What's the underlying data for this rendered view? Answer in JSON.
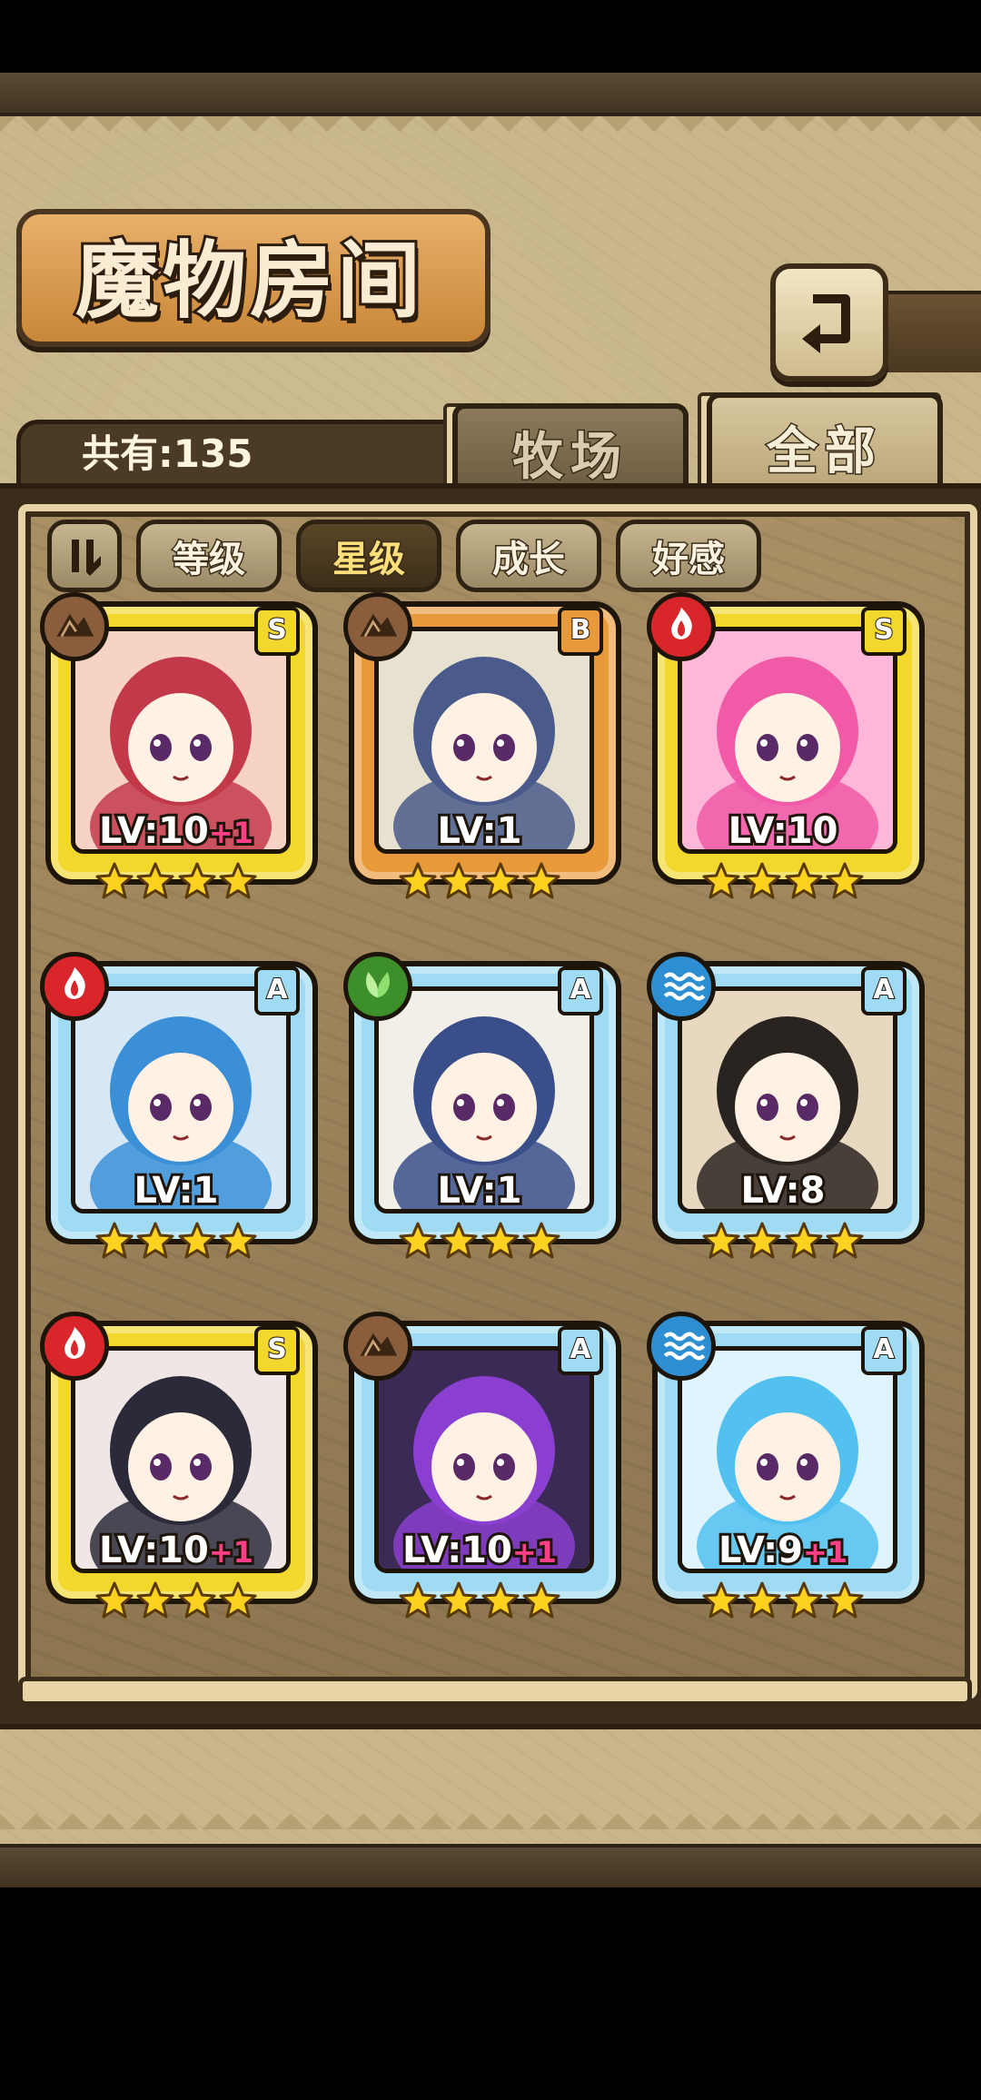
{
  "screen": {
    "title": "魔物房间",
    "back_icon": "back-arrow-icon",
    "total_count": "共有:135"
  },
  "tabs": [
    {
      "label": "牧场",
      "active": false
    },
    {
      "label": "全部",
      "active": true
    }
  ],
  "sort": {
    "toggle_icon": "sort-toggle-icon",
    "buttons": [
      {
        "label": "等级",
        "active": false
      },
      {
        "label": "星级",
        "active": true
      },
      {
        "label": "成长",
        "active": false
      },
      {
        "label": "好感",
        "active": false
      }
    ]
  },
  "colors": {
    "gold_frame": "#f2d72c",
    "bronze_frame": "#e89a3a",
    "blue_frame": "#9fdcf3",
    "earth": "#8a5e3c",
    "fire": "#d9262b",
    "nature": "#3d8f2c",
    "water": "#2d8fd1",
    "level_plus": "#ff3f86"
  },
  "monsters": [
    {
      "rank": "S",
      "element": "earth",
      "level": "LV:10",
      "plus": "+1",
      "stars": 4,
      "frame": "gold"
    },
    {
      "rank": "B",
      "element": "earth",
      "level": "LV:1",
      "plus": "",
      "stars": 4,
      "frame": "bronze"
    },
    {
      "rank": "S",
      "element": "fire",
      "level": "LV:10",
      "plus": "",
      "stars": 4,
      "frame": "gold"
    },
    {
      "rank": "A",
      "element": "fire",
      "level": "LV:1",
      "plus": "",
      "stars": 4,
      "frame": "blue"
    },
    {
      "rank": "A",
      "element": "nature",
      "level": "LV:1",
      "plus": "",
      "stars": 4,
      "frame": "blue"
    },
    {
      "rank": "A",
      "element": "water",
      "level": "LV:8",
      "plus": "",
      "stars": 4,
      "frame": "blue"
    },
    {
      "rank": "S",
      "element": "fire",
      "level": "LV:10",
      "plus": "+1",
      "stars": 4,
      "frame": "gold"
    },
    {
      "rank": "A",
      "element": "earth",
      "level": "LV:10",
      "plus": "+1",
      "stars": 4,
      "frame": "blue"
    },
    {
      "rank": "A",
      "element": "water",
      "level": "LV:9",
      "plus": "+1",
      "stars": 4,
      "frame": "blue"
    }
  ]
}
